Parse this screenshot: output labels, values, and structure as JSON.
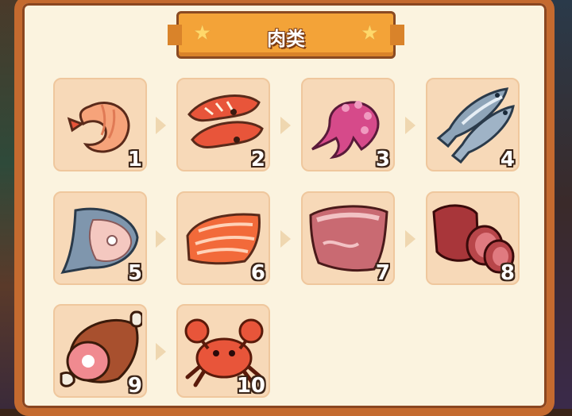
{
  "title": "肉类",
  "items": [
    {
      "number": "1",
      "icon": "shrimp-icon"
    },
    {
      "number": "2",
      "icon": "prawns-icon"
    },
    {
      "number": "3",
      "icon": "octopus-icon"
    },
    {
      "number": "4",
      "icon": "sardines-icon"
    },
    {
      "number": "5",
      "icon": "fish-steak-icon"
    },
    {
      "number": "6",
      "icon": "salmon-fillet-icon"
    },
    {
      "number": "7",
      "icon": "raw-meat-icon"
    },
    {
      "number": "8",
      "icon": "sliced-roast-icon"
    },
    {
      "number": "9",
      "icon": "ham-bone-icon"
    },
    {
      "number": "10",
      "icon": "crab-icon"
    }
  ],
  "colors": {
    "panel_border": "#c46a2f",
    "panel_bg": "#fbf3df",
    "banner": "#f3a338",
    "tile_bg": "#f7d9b8"
  }
}
